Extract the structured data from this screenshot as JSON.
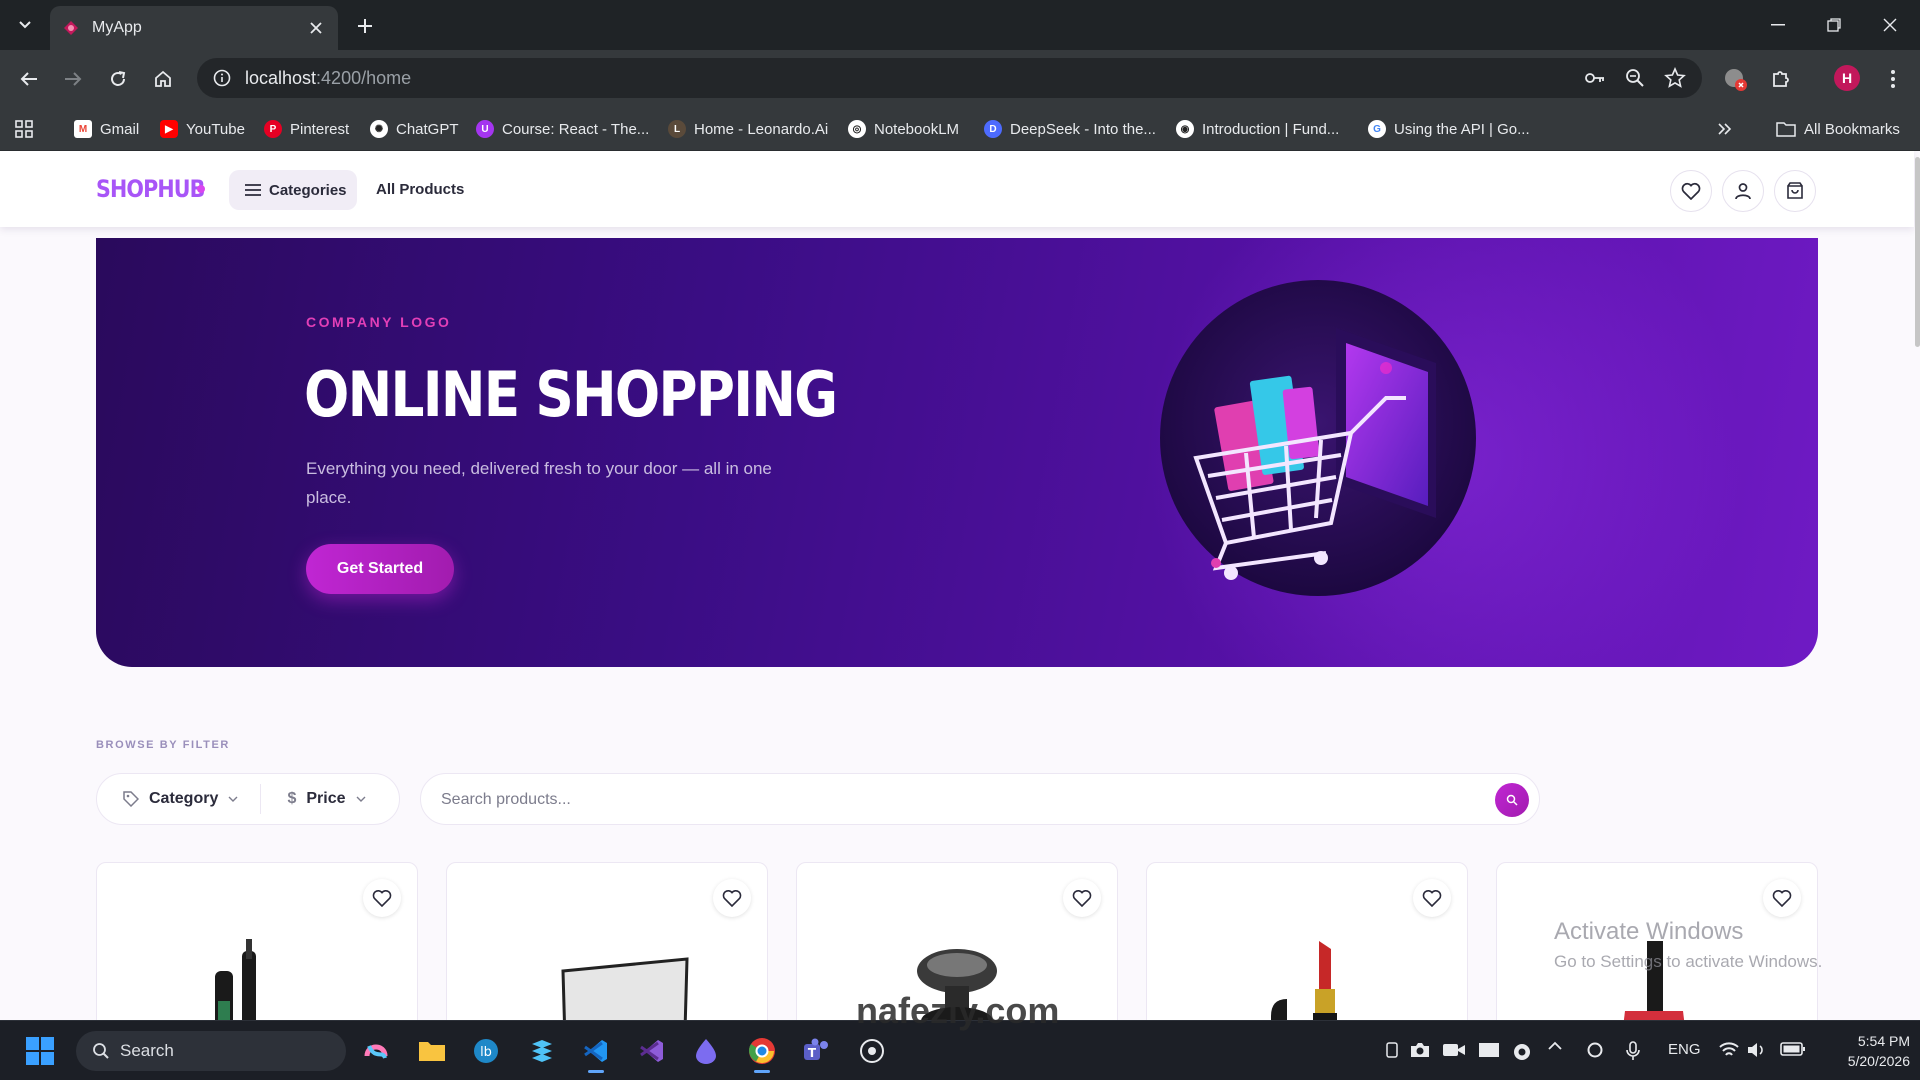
{
  "browser": {
    "tab_title": "MyApp",
    "url_host": "localhost",
    "url_rest": ":4200/home",
    "bookmarks": [
      "Gmail",
      "YouTube",
      "Pinterest",
      "ChatGPT",
      "Course: React - The...",
      "Home - Leonardo.Ai",
      "NotebookLM",
      "DeepSeek - Into the...",
      "Introduction | Fund...",
      "Using the API  |  Go..."
    ],
    "all_bookmarks": "All Bookmarks",
    "profile_initial": "H"
  },
  "header": {
    "logo": "SHOPHUB",
    "categories_label": "Categories",
    "all_products_label": "All Products"
  },
  "hero": {
    "tag": "COMPANY LOGO",
    "title": "ONLINE SHOPPING",
    "subtitle": "Everything you need, delivered fresh to your door — all in one place.",
    "cta": "Get Started"
  },
  "filters": {
    "label": "BROWSE BY FILTER",
    "category": "Category",
    "price": "Price",
    "search_placeholder": "Search products..."
  },
  "products": [
    {
      "icon": "mascara-product-image"
    },
    {
      "icon": "eyeshadow-palette-product-image"
    },
    {
      "icon": "cosmetic-jar-product-image"
    },
    {
      "icon": "lipstick-product-image"
    },
    {
      "icon": "nail-polish-product-image"
    }
  ],
  "overlay": {
    "activate_title": "Activate Windows",
    "activate_sub": "Go to Settings to activate Windows.",
    "watermark": "nafezly.com"
  },
  "taskbar": {
    "search": "Search",
    "lang": "ENG",
    "time": "5:54 PM",
    "date": "5/20/2026"
  },
  "colors": {
    "brand": "#a855f7",
    "accent": "#c026d3",
    "hero_bg": "#3a0d84"
  }
}
